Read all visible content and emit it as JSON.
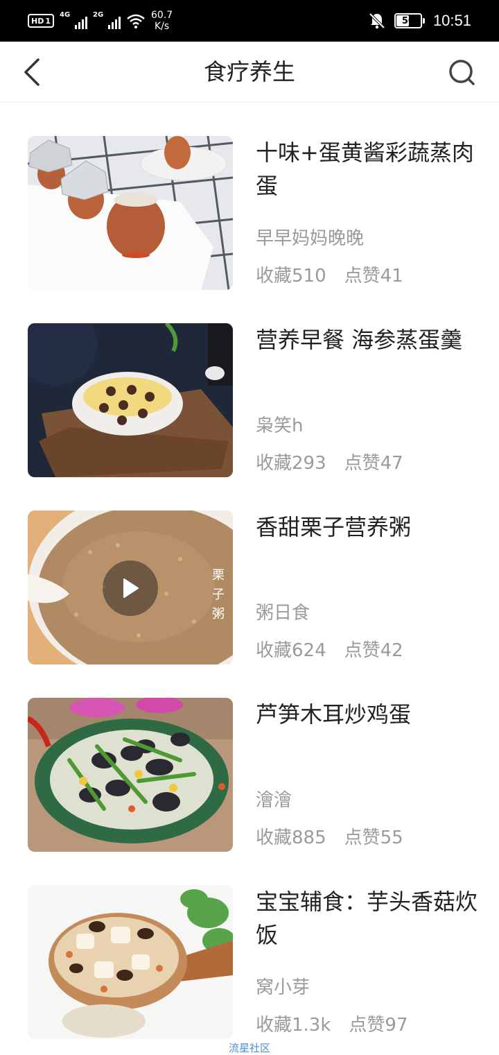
{
  "status_bar": {
    "hd": "HD",
    "sim1_slot": "1",
    "signal_1": "4G",
    "signal_2": "2G",
    "net_speed_value": "60.7",
    "net_speed_unit": "K/s",
    "battery": "50",
    "time": "10:51",
    "icons": [
      "hd-icon",
      "signal-4g-icon",
      "signal-2g-icon",
      "wifi-icon",
      "bell-muted-icon",
      "battery-icon"
    ]
  },
  "header": {
    "title": "食疗养生",
    "back_icon": "chevron-left-icon",
    "search_icon": "search-icon"
  },
  "recipes": [
    {
      "title": "十味+蛋黄酱彩蔬蒸肉蛋",
      "author": "早早妈妈晚晚",
      "favorites": "收藏510",
      "likes": "点赞41",
      "thumbnail": "eggshell-dish-photo"
    },
    {
      "title": "营养早餐 海参蒸蛋羹",
      "author": "枭笑h",
      "favorites": "收藏293",
      "likes": "点赞47",
      "thumbnail": "steamed-egg-bowl-photo"
    },
    {
      "title": "香甜栗子营养粥",
      "author": "粥日食",
      "favorites": "收藏624",
      "likes": "点赞42",
      "thumbnail": "chestnut-porridge-video",
      "thumb_label": "栗子粥"
    },
    {
      "title": "芦笋木耳炒鸡蛋",
      "author": "澮澮",
      "favorites": "收藏885",
      "likes": "点赞55",
      "thumbnail": "asparagus-fungus-plate-photo"
    },
    {
      "title": "宝宝辅食：芋头香菇炊饭",
      "author": "窝小芽",
      "favorites": "收藏1.3k",
      "likes": "点赞97",
      "thumbnail": "taro-rice-spoon-photo"
    }
  ],
  "watermark": "流星社区",
  "colors": {
    "status_bg": "#000000",
    "title_text": "#222222",
    "meta_text": "#9a9a9a",
    "watermark": "#4a8fd8"
  }
}
